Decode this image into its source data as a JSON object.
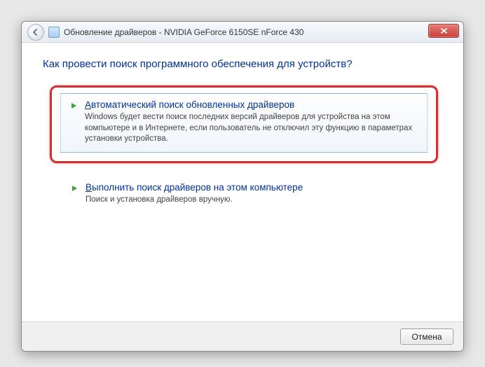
{
  "titlebar": {
    "title": "Обновление драйверов - NVIDIA GeForce 6150SE nForce 430"
  },
  "question": "Как провести поиск программного обеспечения для устройств?",
  "options": {
    "auto": {
      "title_prefix": "А",
      "title_rest": "втоматический поиск обновленных драйверов",
      "desc": "Windows будет вести поиск последних версий драйверов для устройства на этом компьютере и в Интернете, если пользователь не отключил эту функцию в параметрах установки устройства."
    },
    "manual": {
      "title_prefix": "В",
      "title_rest": "ыполнить поиск драйверов на этом компьютере",
      "desc": "Поиск и установка драйверов вручную."
    }
  },
  "footer": {
    "cancel": "Отмена"
  }
}
